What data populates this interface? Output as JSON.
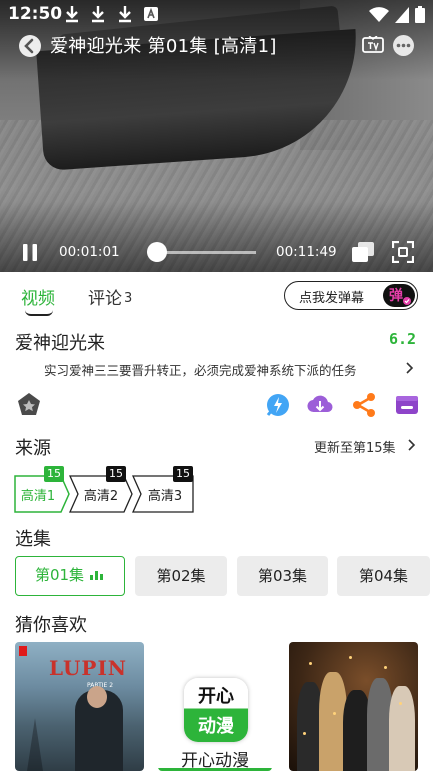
{
  "status_bar": {
    "time": "12:50"
  },
  "player": {
    "title": "爱神迎光来 第01集 [高清1]",
    "current_time": "00:01:01",
    "total_time": "00:11:49",
    "progress_fraction": 0.086
  },
  "tabs": {
    "video": "视频",
    "comment": "评论",
    "comment_count": "3"
  },
  "danmu": {
    "placeholder": "点我发弹幕",
    "toggle": "弹"
  },
  "show": {
    "title": "爱神迎光来",
    "score": "6.2",
    "description": "实习爱神三三要晋升转正，必须完成爱神系统下派的任务"
  },
  "actions": [
    "collect-icon",
    "speed-icon",
    "download-icon",
    "share-icon",
    "cast-icon"
  ],
  "source": {
    "heading": "来源",
    "update_text": "更新至第15集",
    "items": [
      {
        "label": "高清1",
        "count": "15"
      },
      {
        "label": "高清2",
        "count": "15"
      },
      {
        "label": "高清3",
        "count": "15"
      }
    ]
  },
  "episodes": {
    "heading": "选集",
    "items": [
      "第01集",
      "第02集",
      "第03集",
      "第04集"
    ]
  },
  "recommend": {
    "heading": "猜你喜欢",
    "lupin_logo": "LUPIN",
    "lupin_sub": "PARTIE 2",
    "app_icon_line1": "开心",
    "app_icon_line2": "动漫",
    "app_name": "开心动漫"
  },
  "colors": {
    "accent": "#2db43a",
    "danmu_toggle": "#e43ea8",
    "badge": "#111111"
  }
}
